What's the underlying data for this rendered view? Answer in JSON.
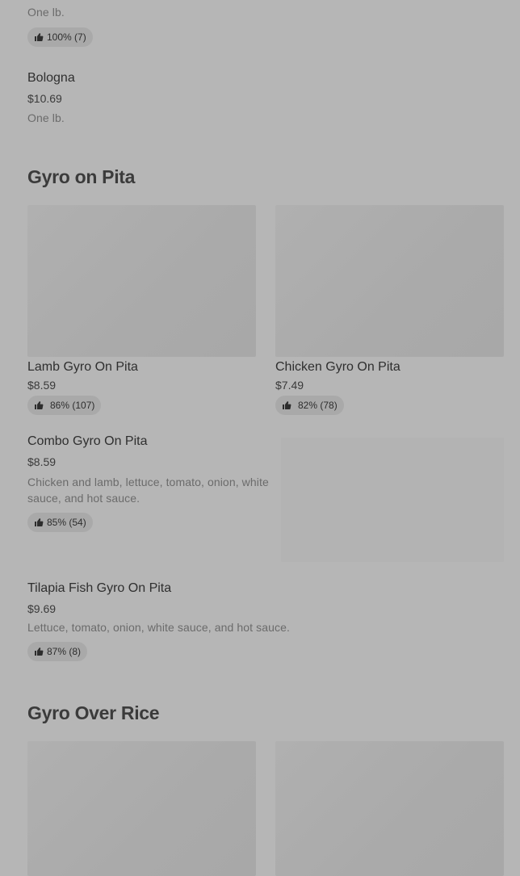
{
  "top_item": {
    "desc": "One lb.",
    "rating": "100% (7)"
  },
  "bologna": {
    "title": "Bologna",
    "price": "$10.69",
    "desc": "One lb."
  },
  "section_gyro_pita": {
    "title": "Gyro on Pita",
    "cards": [
      {
        "title": "Lamb Gyro On Pita",
        "price": "$8.59",
        "rating": "86% (107)"
      },
      {
        "title": "Chicken Gyro On Pita",
        "price": "$7.49",
        "rating": "82% (78)"
      }
    ],
    "combo": {
      "title": "Combo Gyro On Pita",
      "price": "$8.59",
      "desc": "Chicken and lamb, lettuce, tomato, onion, white sauce, and hot sauce.",
      "rating": "85% (54)"
    },
    "tilapia": {
      "title": "Tilapia Fish Gyro On Pita",
      "price": "$9.69",
      "desc": "Lettuce, tomato, onion, white sauce, and hot sauce.",
      "rating": "87% (8)"
    }
  },
  "section_gyro_rice": {
    "title": "Gyro Over Rice"
  },
  "icons": {
    "rating": "thumbs-up-icon"
  }
}
